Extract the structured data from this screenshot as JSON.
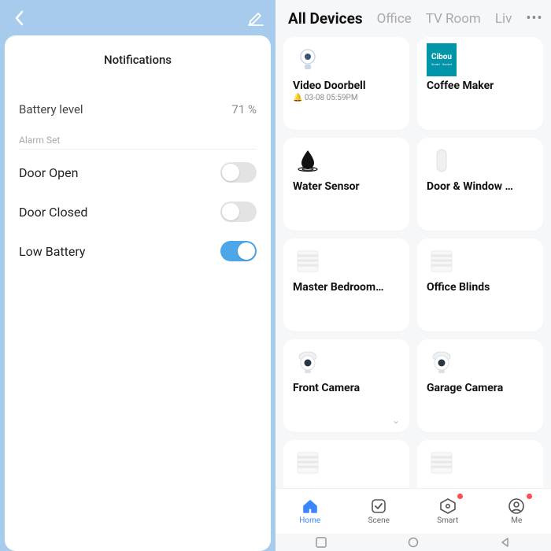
{
  "left": {
    "title": "Notifications",
    "battery_label": "Battery level",
    "battery_value": "71 %",
    "section_label": "Alarm Set",
    "toggles": [
      {
        "label": "Door Open",
        "on": false
      },
      {
        "label": "Door Closed",
        "on": false
      },
      {
        "label": "Low Battery",
        "on": true
      }
    ]
  },
  "right": {
    "tabs": [
      "All Devices",
      "Office",
      "TV Room",
      "Liv"
    ],
    "active_tab": 0,
    "devices": [
      {
        "name": "Video Doorbell",
        "sub": "03-08 05:59PM",
        "icon": "doorbell",
        "has_sub_icon": true
      },
      {
        "name": "Coffee Maker",
        "icon": "cibou"
      },
      {
        "name": "Water Sensor",
        "icon": "water"
      },
      {
        "name": "Door & Window …",
        "icon": "contact"
      },
      {
        "name": "Master Bedroom…",
        "icon": "blinds"
      },
      {
        "name": "Office Blinds",
        "icon": "blinds"
      },
      {
        "name": "Front Camera",
        "icon": "cam",
        "chevron": true
      },
      {
        "name": "Garage Camera",
        "icon": "cam"
      }
    ],
    "nav": [
      {
        "label": "Home",
        "icon": "home",
        "active": true
      },
      {
        "label": "Scene",
        "icon": "scene"
      },
      {
        "label": "Smart",
        "icon": "smart",
        "dot": true
      },
      {
        "label": "Me",
        "icon": "me",
        "dot": true
      }
    ]
  }
}
